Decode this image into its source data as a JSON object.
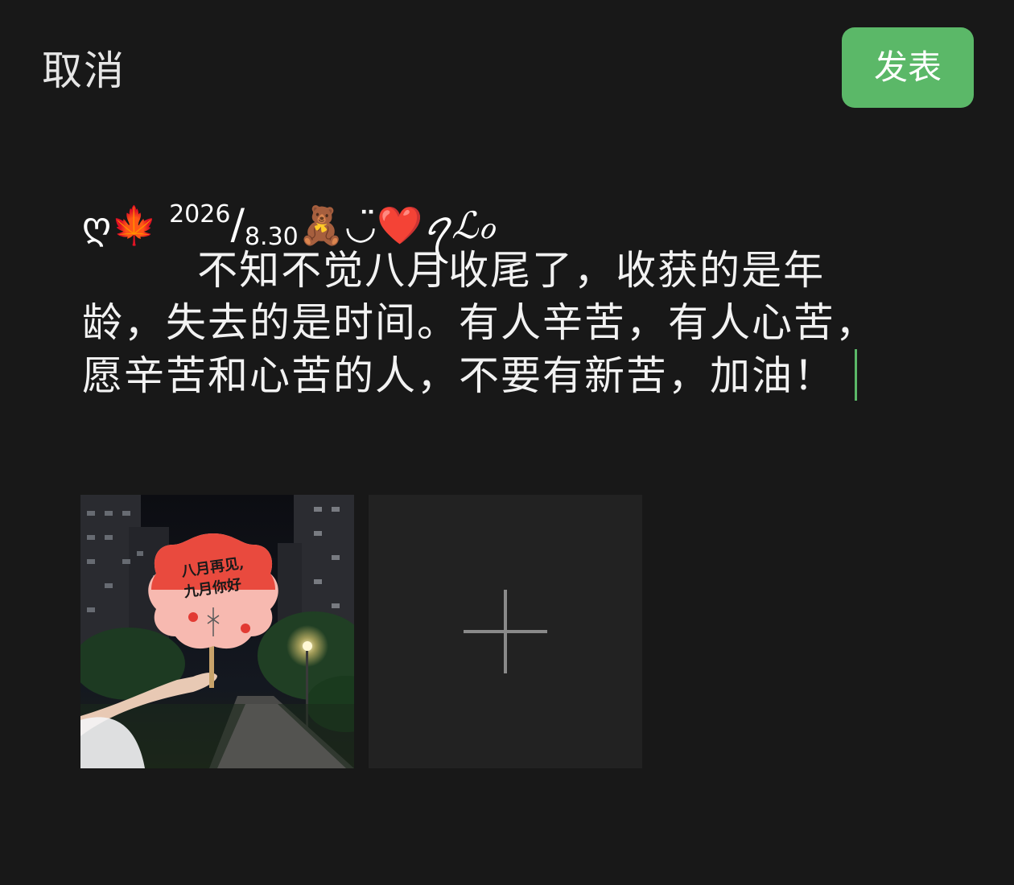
{
  "header": {
    "cancel_label": "取消",
    "publish_label": "发表"
  },
  "composer": {
    "deco_prefix": "ღ",
    "maple_emoji": "🍁",
    "date_year": "2026",
    "date_slash": "/",
    "date_monthday": "8.30",
    "bear_emoji": "🧸",
    "kaomoji": "◡̈",
    "heart_emoji": "❤️",
    "deco_suffix": "ꪖℒℴ",
    "body": "        不知不觉八月收尾了，收获的是年龄，失去的是时间。有人辛苦，有人心苦，愿辛苦和心苦的人，不要有新苦，加油！"
  },
  "photo": {
    "fan_line1": "八月再见,",
    "fan_line2": "九月你好"
  },
  "colors": {
    "background": "#181818",
    "accent_green": "#5bb868",
    "add_tile": "#222222",
    "plus_icon": "#8a8a8a"
  },
  "icons": {
    "add": "plus-icon",
    "cursor": "text-caret"
  }
}
